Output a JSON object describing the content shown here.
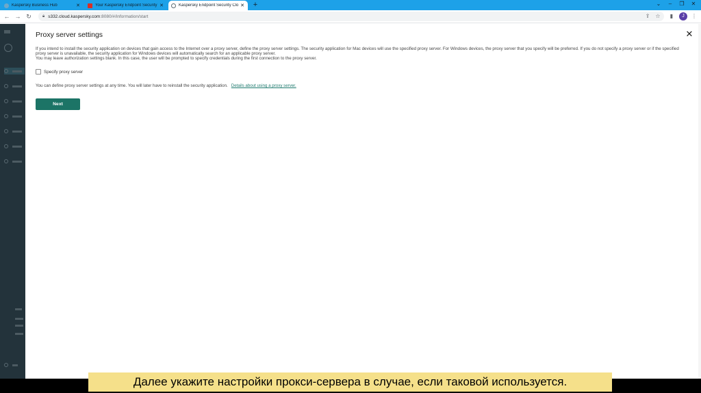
{
  "browser": {
    "tabs": [
      {
        "label": "Kaspersky Business Hub",
        "active": false
      },
      {
        "label": "Your Kaspersky Endpoint Security",
        "active": false
      },
      {
        "label": "Kaspersky Endpoint Security Clo",
        "active": true
      }
    ],
    "new_tab_label": "+",
    "url_host": "s332.cloud.kaspersky.com",
    "url_path": ":8080/#/information/start",
    "profile_initial": "J"
  },
  "modal": {
    "title": "Proxy server settings",
    "description_line1": "If you intend to install the security application on devices that gain access to the Internet over a proxy server, define the proxy server settings. The security application for Mac devices will use the specified proxy server. For Windows devices, the proxy server that you specify will be preferred. If you do not specify a proxy server or if the specified proxy server is unavailable, the security application for Windows devices will automatically search for an applicable proxy server.",
    "description_line2": "You may leave authorization settings blank. In this case, the user will be prompted to specify credentials during the first connection to the proxy server.",
    "checkbox_label": "Specify proxy server",
    "checkbox_checked": false,
    "hint_text": "You can define proxy server settings at any time. You will later have to reinstall the security application.",
    "hint_link": "Details about using a proxy server.",
    "next_button": "Next"
  },
  "subtitle": "Далее укажите настройки прокси-сервера в случае, если таковой используется.",
  "colors": {
    "tabstrip": "#1da1e8",
    "accent": "#1c7466",
    "link": "#1e7a6e",
    "sidebar": "#23333b",
    "subtitle_bg": "#f5e08a"
  }
}
